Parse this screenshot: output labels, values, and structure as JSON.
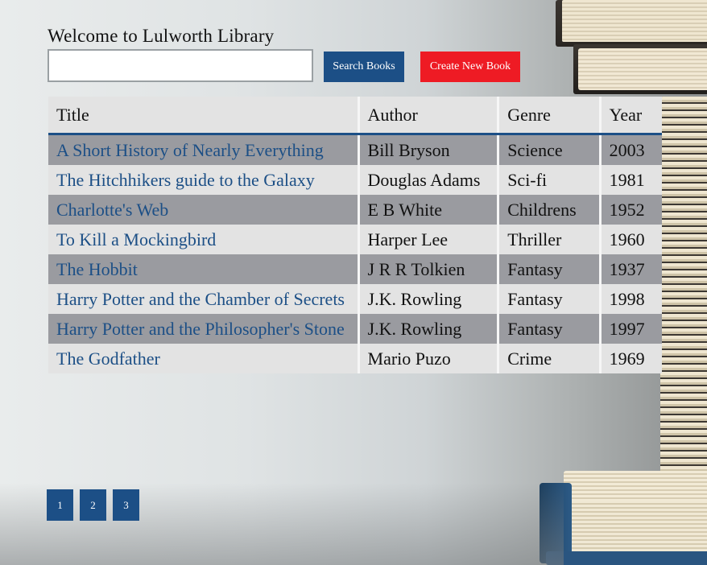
{
  "header": {
    "welcome": "Welcome to Lulworth Library",
    "search_placeholder": "",
    "search_value": "",
    "search_button": "Search Books",
    "create_button": "Create New Book"
  },
  "colors": {
    "primary": "#1c4f86",
    "danger": "#ee1b24"
  },
  "table": {
    "headers": [
      "Title",
      "Author",
      "Genre",
      "Year"
    ],
    "rows": [
      {
        "title": "A Short History of Nearly Everything",
        "author": "Bill Bryson",
        "genre": "Science",
        "year": "2003"
      },
      {
        "title": "The Hitchhikers guide to the Galaxy",
        "author": "Douglas Adams",
        "genre": "Sci-fi",
        "year": "1981"
      },
      {
        "title": "Charlotte's Web",
        "author": "E B White",
        "genre": "Childrens",
        "year": "1952"
      },
      {
        "title": "To Kill a Mockingbird",
        "author": "Harper Lee",
        "genre": "Thriller",
        "year": "1960"
      },
      {
        "title": "The Hobbit",
        "author": "J R R Tolkien",
        "genre": "Fantasy",
        "year": "1937"
      },
      {
        "title": "Harry Potter and the Chamber of Secrets",
        "author": "J.K. Rowling",
        "genre": "Fantasy",
        "year": "1998"
      },
      {
        "title": "Harry Potter and the Philosopher's Stone",
        "author": "J.K. Rowling",
        "genre": "Fantasy",
        "year": "1997"
      },
      {
        "title": "The Godfather",
        "author": "Mario Puzo",
        "genre": "Crime",
        "year": "1969"
      }
    ]
  },
  "pagination": {
    "pages": [
      "1",
      "2",
      "3"
    ]
  }
}
